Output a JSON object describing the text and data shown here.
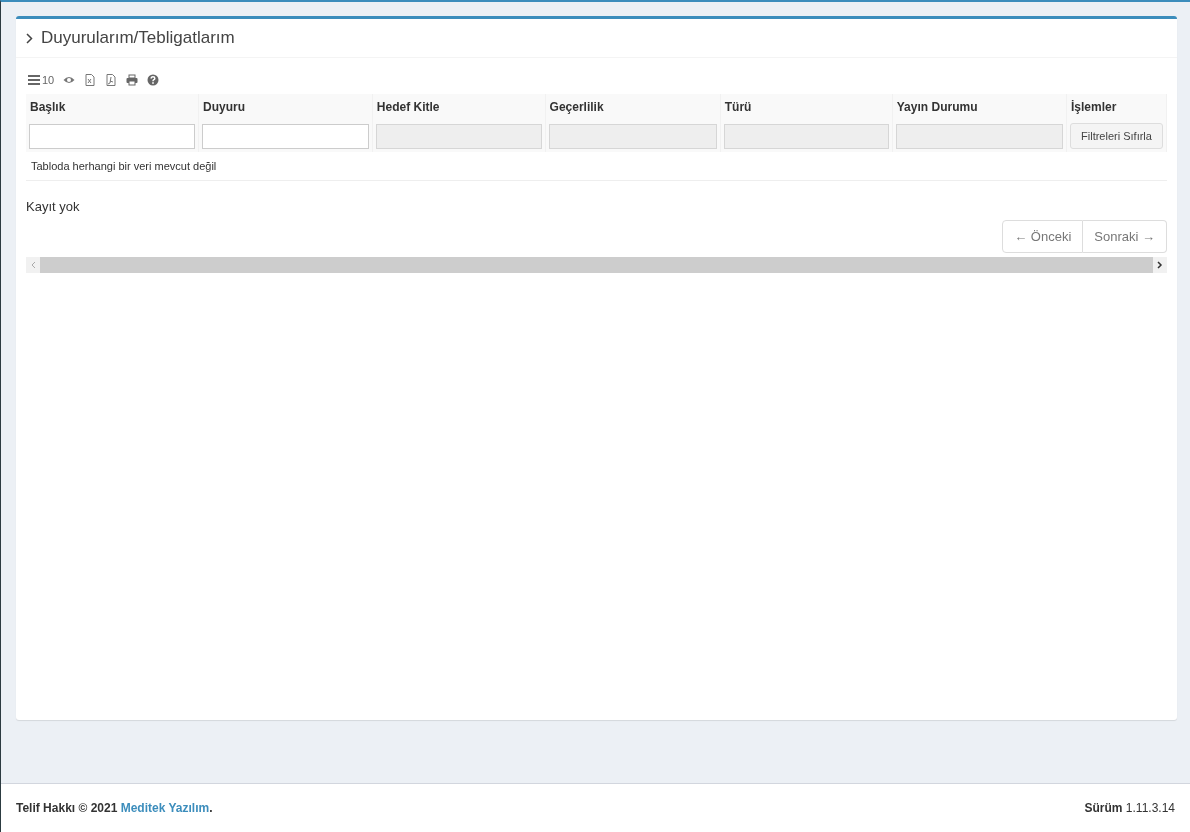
{
  "panel": {
    "title": "Duyurularım/Tebligatlarım"
  },
  "toolbar": {
    "page_length": "10"
  },
  "table": {
    "columns": [
      {
        "label": "Başlık",
        "filter_disabled": false
      },
      {
        "label": "Duyuru",
        "filter_disabled": false
      },
      {
        "label": "Hedef Kitle",
        "filter_disabled": true
      },
      {
        "label": "Geçerlilik",
        "filter_disabled": true
      },
      {
        "label": "Türü",
        "filter_disabled": true
      },
      {
        "label": "Yayın Durumu",
        "filter_disabled": true
      },
      {
        "label": "İşlemler",
        "kind": "actions"
      }
    ],
    "reset_button": "Filtreleri Sıfırla",
    "empty_message": "Tabloda herhangi bir veri mevcut değil"
  },
  "info": "Kayıt yok",
  "pagination": [
    {
      "label": "← Önceki",
      "disabled": true
    },
    {
      "label": "Sonraki →",
      "disabled": true
    }
  ],
  "footer": {
    "copyright_prefix": "Telif Hakkı © 2021 ",
    "company": "Meditek Yazılım",
    "copyright_suffix": ".",
    "version": "**Sürüm** 1.11.3.14"
  }
}
